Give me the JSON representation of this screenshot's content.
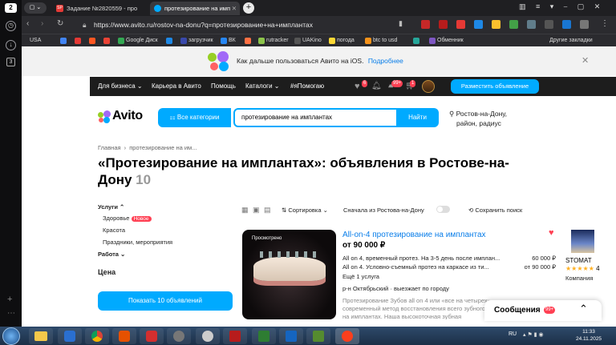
{
  "browser": {
    "side_badge": "2",
    "side_count": "3",
    "tabs": [
      {
        "label": "Задание №2820559 - про",
        "icon_color": "#e53935"
      },
      {
        "label": "протезирование на имп",
        "icon_color": "#00aaff"
      }
    ],
    "url": "https://www.avito.ru/rostov-na-donu?q=протезирование+на+имплантах",
    "bookmarks": [
      {
        "label": "USA",
        "color": ""
      },
      {
        "label": "",
        "color": "#4285f4"
      },
      {
        "label": "",
        "color": "#e53935"
      },
      {
        "label": "",
        "color": "#ff5722"
      },
      {
        "label": "",
        "color": "#ea4335"
      },
      {
        "label": "Google Диск",
        "color": "#34a853"
      },
      {
        "label": "",
        "color": "#1e88e5"
      },
      {
        "label": "загрузчик",
        "color": "#3949ab"
      },
      {
        "label": "ВК",
        "color": "#2787f5"
      },
      {
        "label": "",
        "color": "#ff7043"
      },
      {
        "label": "rutracker",
        "color": "#8bc34a"
      },
      {
        "label": "UAKino",
        "color": "#555"
      },
      {
        "label": "погода",
        "color": "#fdd835"
      },
      {
        "label": "btc to usd",
        "color": "#f7931a"
      },
      {
        "label": "",
        "color": "#26a69a"
      },
      {
        "label": "Обменник",
        "color": "#7e57c2"
      }
    ],
    "other_bookmarks": "Другие закладки"
  },
  "banner": {
    "text": "Как дальше пользоваться Авито на iOS.",
    "link": "Подробнее"
  },
  "topnav": {
    "items": [
      "Для бизнеса",
      "Карьера в Авито",
      "Помощь",
      "Каталоги",
      "#яПомогаю"
    ],
    "badge_fav": "6",
    "badge_msg": "99+",
    "badge_cart": "1",
    "post_button": "Разместить объявление"
  },
  "header": {
    "logo": "Avito",
    "all_categories": "Все категории",
    "search_value": "протезирование на имплантах",
    "search_button": "Найти",
    "location": "Ростов-на-Дону,",
    "radius": "район, радиус"
  },
  "breadcrumb": {
    "home": "Главная",
    "sep": "›",
    "current": "протезирование на им..."
  },
  "title": {
    "text": "«Протезирование на имплантах»: объявления в Ростове-на-Дону",
    "count": "10"
  },
  "filters": {
    "services_label": "Услуги",
    "items": [
      "Здоровье",
      "Красота",
      "Праздники, мероприятия"
    ],
    "new_badge": "Новое",
    "work_label": "Работа",
    "price_label": "Цена",
    "show_button": "Показать 10 объявлений"
  },
  "toolbar": {
    "sort": "Сортировка",
    "local_first": "Сначала из Ростова-на-Дону",
    "save_search": "Сохранить поиск"
  },
  "listing": {
    "image_badge": "Просмотрено",
    "title": "All-on-4 протезирование на имплантах",
    "price": "от 90 000 ₽",
    "lines": [
      {
        "text": "All on 4, временный протез. На 3-5 день после имплан...",
        "price": "60 000 ₽"
      },
      {
        "text": "All on 4. Условно-съемный протез на каркасе из ти...",
        "price": "от 90 000 ₽"
      }
    ],
    "more": "Ещё 1 услуга",
    "location": "р-н Октябрьский · выезжает по городу",
    "description": "Протезирование Зубов all on 4 или «все на четырех» — современный метод восстановления всего зубного ряда на имплантах. Наша высокоточная зубная",
    "seller_name": "STOMAT",
    "seller_rating": "4",
    "seller_type": "Компания"
  },
  "messages": {
    "label": "Сообщения",
    "badge": "99+"
  },
  "taskbar": {
    "lang": "RU",
    "time": "11:33",
    "date": "24.11.2025"
  }
}
